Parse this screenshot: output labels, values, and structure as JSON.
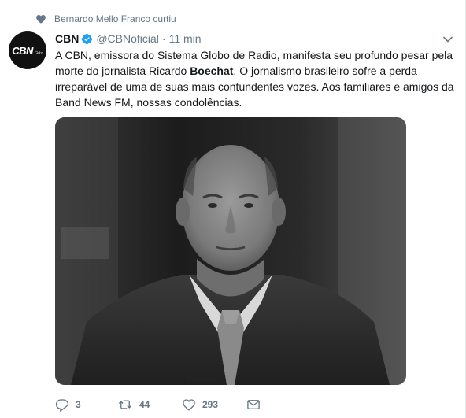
{
  "social_context": {
    "icon": "heart-icon",
    "text": "Bernardo Mello Franco curtiu"
  },
  "tweet": {
    "avatar_logo": "CBN",
    "avatar_logo_sub": "Globo",
    "name": "CBN",
    "verified": true,
    "handle": "@CBNoficial",
    "separator": "·",
    "time": "11 min",
    "text_part1": "A CBN, emissora do Sistema Globo de Radio, manifesta seu profundo pesar pela morte do jornalista Ricardo ",
    "text_bold": "Boechat",
    "text_part2": ". O jornalismo brasileiro sofre a perda irreparável de uma de suas mais contundentes vozes. Aos familiares e amigos da Band News FM, nossas condolências.",
    "media": {
      "type": "photo",
      "icon": "photo-portrait"
    }
  },
  "actions": {
    "reply_count": "3",
    "retweet_count": "44",
    "like_count": "293"
  },
  "colors": {
    "secondary_text": "#657786",
    "verified_blue": "#1da1f2",
    "text": "#14171a"
  }
}
